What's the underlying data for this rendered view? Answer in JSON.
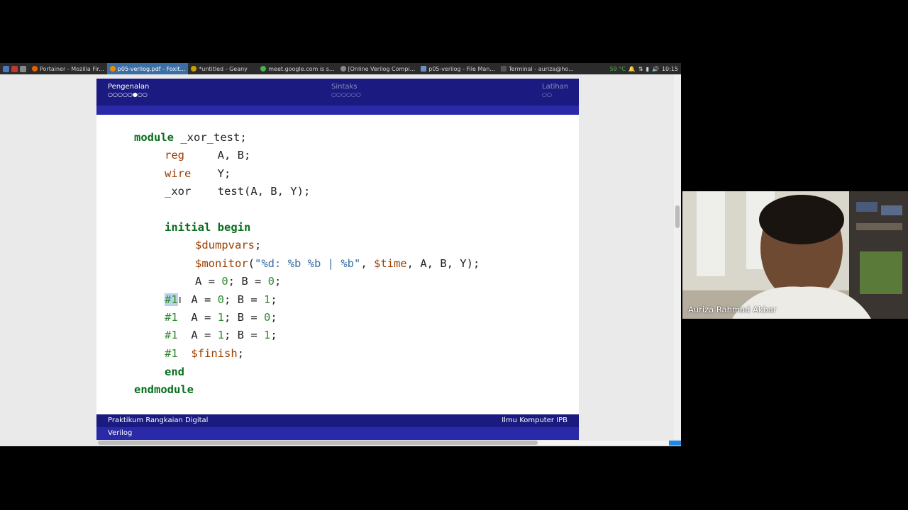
{
  "taskbar": {
    "tasks": [
      {
        "label": "Portainer - Mozilla Fir...",
        "active": false,
        "icon": "firefox-icon",
        "color": "#e66000"
      },
      {
        "label": "p05-verilog.pdf - Foxit...",
        "active": true,
        "icon": "foxit-icon",
        "color": "#f08a00"
      },
      {
        "label": "*untitled - Geany",
        "active": false,
        "icon": "geany-icon",
        "color": "#c8a000"
      },
      {
        "label": "meet.google.com is s...",
        "active": false,
        "icon": "chrome-icon",
        "color": "#4caf50"
      },
      {
        "label": "[Online Verilog Compi...",
        "active": false,
        "icon": "browser-icon",
        "color": "#888888"
      },
      {
        "label": "p05-verilog - File Man...",
        "active": false,
        "icon": "folder-icon",
        "color": "#6a8fc7"
      },
      {
        "label": "Terminal - auriza@ho...",
        "active": false,
        "icon": "terminal-icon",
        "color": "#555555"
      }
    ],
    "tray": {
      "temp": "59 °C",
      "clock": "10:15"
    }
  },
  "slide": {
    "nav": {
      "sections": [
        {
          "label": "Pengenalan",
          "dots": "○○○○○●○○",
          "active": true
        },
        {
          "label": "Sintaks",
          "dots": "○○○○○○",
          "active": false
        },
        {
          "label": "Latihan",
          "dots": "○○",
          "active": false
        }
      ]
    },
    "footer": {
      "course": "Praktikum Rangkaian Digital",
      "topic": "Verilog",
      "institution": "Ilmu Komputer IPB"
    },
    "code": {
      "l1_kw": "module",
      "l1_rest": " _xor_test;",
      "l2_ty": "reg",
      "l2_rest": "     A, B;",
      "l3_ty": "wire",
      "l3_rest": "    Y;",
      "l4_name": "_xor",
      "l4_rest": "    test(A, B, Y);",
      "l5_kw1": "initial",
      "l5_kw2": "begin",
      "l6_sys": "$dumpvars",
      "l6_rest": ";",
      "l7_sys": "$monitor",
      "l7_p1": "(",
      "l7_str": "\"%d: %b %b | %b\"",
      "l7_p2": ", ",
      "l7_sys2": "$time",
      "l7_p3": ", A, B, Y);",
      "l8_a": "A = ",
      "l8_av": "0",
      "l8_b": "; B = ",
      "l8_bv": "0",
      "l8_e": ";",
      "l9_delay": "#1",
      "l9_a": "A = ",
      "l9_av": "0",
      "l9_b": "; B = ",
      "l9_bv": "1",
      "l9_e": ";",
      "l10_delay": "#1",
      "l10_a": "A = ",
      "l10_av": "1",
      "l10_b": "; B = ",
      "l10_bv": "0",
      "l10_e": ";",
      "l11_delay": "#1",
      "l11_a": "A = ",
      "l11_av": "1",
      "l11_b": "; B = ",
      "l11_bv": "1",
      "l11_e": ";",
      "l12_delay": "#1",
      "l12_sys": "$finish",
      "l12_rest": ";",
      "l13_kw": "end",
      "l14_kw": "endmodule"
    }
  },
  "video": {
    "participant_name": "Auriza Rahmad Akbar"
  }
}
